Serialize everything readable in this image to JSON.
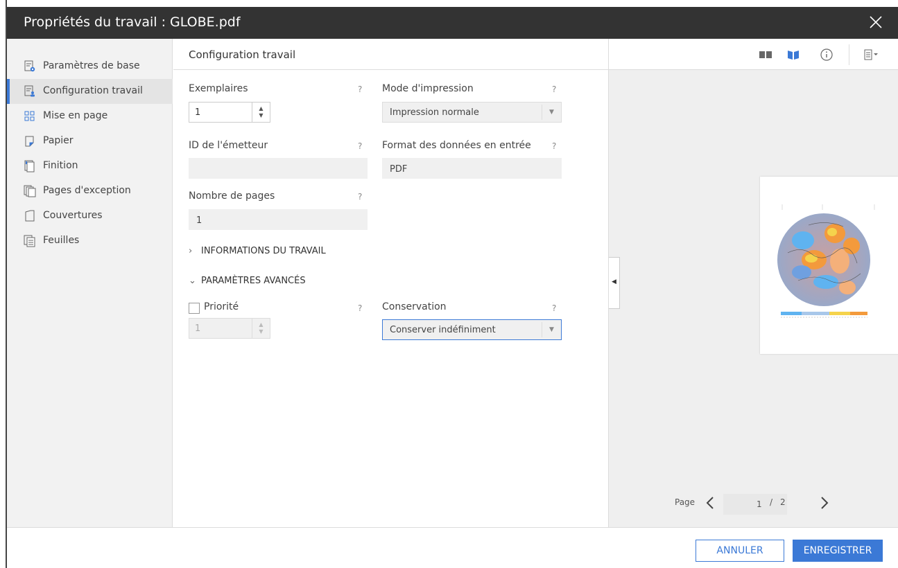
{
  "window": {
    "title": "Propriétés du travail : GLOBE.pdf"
  },
  "sidebar": {
    "items": [
      {
        "label": "Paramètres de base",
        "icon": "basic-settings-icon"
      },
      {
        "label": "Configuration travail",
        "icon": "job-configuration-icon",
        "active": true
      },
      {
        "label": "Mise en page",
        "icon": "layout-grid-icon"
      },
      {
        "label": "Papier",
        "icon": "paper-icon"
      },
      {
        "label": "Finition",
        "icon": "finishing-icon"
      },
      {
        "label": "Pages d'exception",
        "icon": "exception-pages-icon"
      },
      {
        "label": "Couvertures",
        "icon": "covers-icon"
      },
      {
        "label": "Feuilles",
        "icon": "sheets-icon"
      }
    ]
  },
  "main": {
    "header": "Configuration travail",
    "help_symbol": "?",
    "fields": {
      "copies": {
        "label": "Exemplaires",
        "value": "1"
      },
      "print_mode": {
        "label": "Mode d'impression",
        "value": "Impression normale"
      },
      "sender_id": {
        "label": "ID de l'émetteur",
        "value": ""
      },
      "input_format": {
        "label": "Format des données en entrée",
        "value": "PDF"
      },
      "page_count": {
        "label": "Nombre de pages",
        "value": "1"
      }
    },
    "sections": {
      "job_info": "INFORMATIONS DU TRAVAIL",
      "advanced": "PARAMÈTRES AVANCÉS"
    },
    "advanced": {
      "priority": {
        "label": "Priorité",
        "value": "1",
        "checked": false
      },
      "retention": {
        "label": "Conservation",
        "value": "Conserver indéfiniment"
      }
    }
  },
  "preview": {
    "pager": {
      "label": "Page",
      "current": "1",
      "separator": "/",
      "total": "2"
    }
  },
  "footer": {
    "cancel": "ANNULER",
    "save": "ENREGISTRER"
  },
  "colors": {
    "accent": "#3b79d6",
    "titlebar": "#333333"
  }
}
